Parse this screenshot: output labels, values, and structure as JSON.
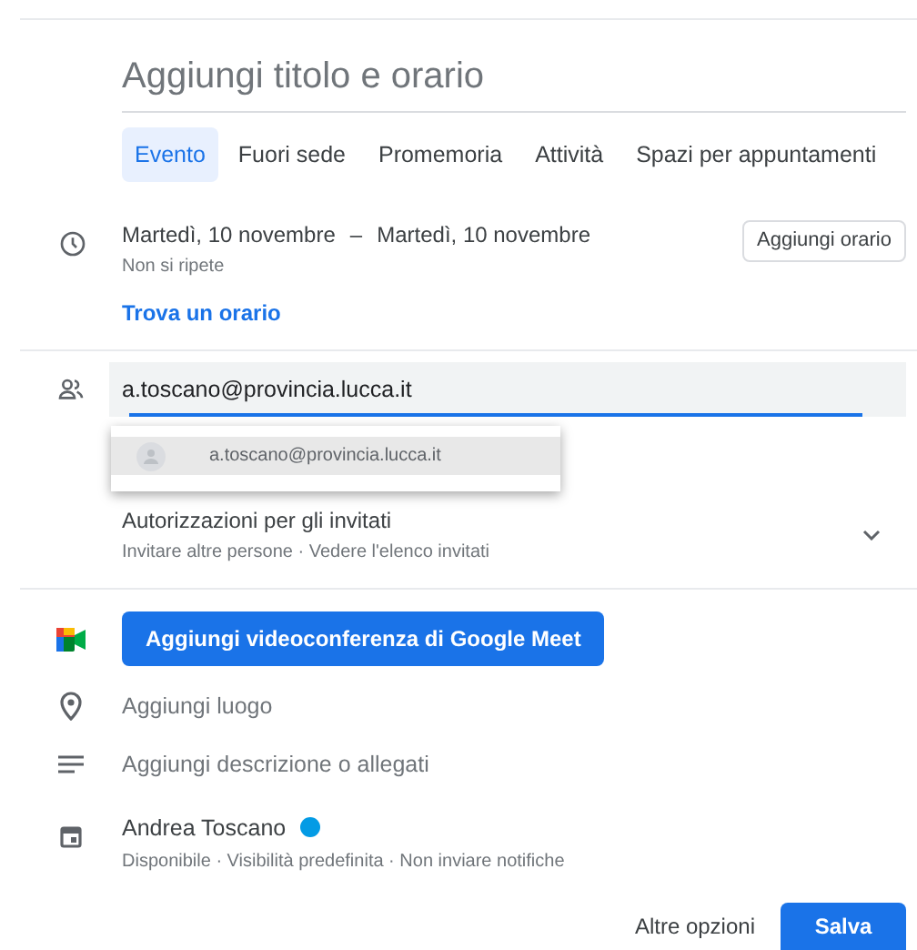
{
  "title_field": {
    "placeholder": "Aggiungi titolo e orario"
  },
  "tabs": [
    {
      "label": "Evento",
      "selected": true
    },
    {
      "label": "Fuori sede",
      "selected": false
    },
    {
      "label": "Promemoria",
      "selected": false
    },
    {
      "label": "Attività",
      "selected": false
    },
    {
      "label": "Spazi per appuntamenti",
      "selected": false
    }
  ],
  "date": {
    "start": "Martedì, 10 novembre",
    "separator": "–",
    "end": "Martedì, 10 novembre",
    "repeat": "Non si ripete",
    "add_time_button": "Aggiungi orario",
    "find_time_link": "Trova un orario"
  },
  "guests": {
    "value": "a.toscano@provincia.lucca.it",
    "suggestions": [
      {
        "email": "a.toscano@provincia.lucca.it",
        "selected": true
      }
    ],
    "permissions_title": "Autorizzazioni per gli invitati",
    "permissions_detail": "Invitare altre persone · Vedere l'elenco invitati"
  },
  "meet_button": "Aggiungi videoconferenza di Google Meet",
  "location": {
    "placeholder": "Aggiungi luogo"
  },
  "description": {
    "placeholder": "Aggiungi descrizione o allegati"
  },
  "calendar": {
    "owner": "Andrea Toscano",
    "color": "#039be5",
    "details": "Disponibile · Visibilità predefinita · Non inviare notifiche"
  },
  "footer": {
    "more_options": "Altre opzioni",
    "save": "Salva"
  }
}
